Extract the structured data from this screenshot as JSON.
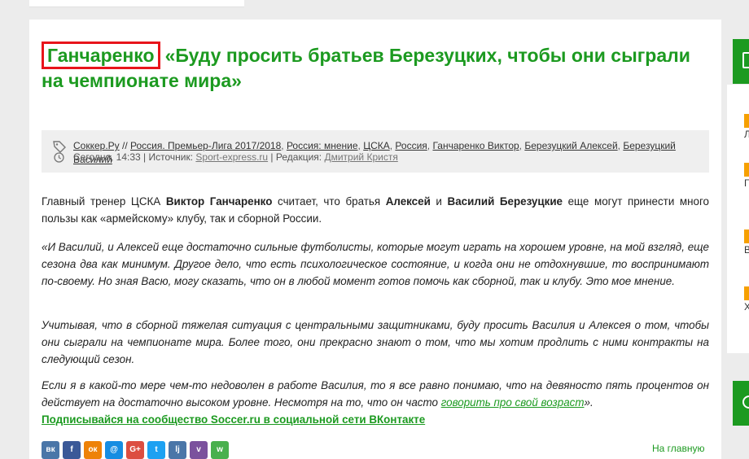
{
  "article": {
    "title_name": "Ганчаренко",
    "title_rest": "«Буду просить братьев Березуцких, чтобы они сыграли на чемпионате мира»",
    "meta": {
      "tags": [
        "Соккер.Ру",
        "Россия. Премьер-Лига 2017/2018",
        "Россия: мнение",
        "ЦСКА",
        "Россия",
        "Ганчаренко Виктор",
        "Березуцкий Алексей",
        "Березуцкий Василий"
      ],
      "tag_sep_first": " // ",
      "date": "Сегодня, 14:33",
      "source_label": "Источник:",
      "source_value": "Sport-express.ru",
      "editor_label": "Редакция:",
      "editor_value": "Дмитрий Кристя"
    },
    "p1": {
      "t1": "Главный тренер ЦСКА ",
      "b1": "Виктор Ганчаренко",
      "t2": " считает, что братья ",
      "b2": "Алексей",
      "t3": " и ",
      "b3": "Василий Березуцкие",
      "t4": " еще могут принести много пользы как «армейскому» клубу, так и сборной России."
    },
    "p2": "«И Василий, и Алексей еще достаточно сильные футболисты, которые могут играть на хорошем уровне, на мой взгляд, еще сезона два как минимум. Другое дело, что есть психологическое состояние, и когда они не отдохнувшие, то воспринимают по-своему. Но зная Васю, могу сказать, что он в любой момент готов помочь как сборной, так и клубу. Это мое мнение.",
    "p3": "Учитывая, что в сборной тяжелая ситуация с центральными защитниками, буду просить Василия и Алексея о том, чтобы они сыграли на чемпионате мира. Более того, они прекрасно знают о том, что мы хотим продлить с ними контракты на следующий сезон.",
    "p4": {
      "text": "Если я в какой-то мере чем-то недоволен в работе Василия, то я все равно понимаю, что на девяносто пять процентов он действует на достаточно высоком уровне. Несмотря на то, что он часто ",
      "link": "говорить про свой возраст",
      "end": "»."
    },
    "vk_link": "Подписывайся на сообщество Soccer.ru в социальной сети ВКонтакте",
    "share_buttons": [
      {
        "icon": "vk-icon",
        "glyph": "вк",
        "color": "#4a76a8"
      },
      {
        "icon": "facebook-icon",
        "glyph": "f",
        "color": "#3b5998"
      },
      {
        "icon": "odnoklassniki-icon",
        "glyph": "ок",
        "color": "#ee8208"
      },
      {
        "icon": "moimir-icon",
        "glyph": "@",
        "color": "#168de2"
      },
      {
        "icon": "google-plus-icon",
        "glyph": "G+",
        "color": "#dc4e41"
      },
      {
        "icon": "twitter-icon",
        "glyph": "t",
        "color": "#1da1f2"
      },
      {
        "icon": "livejournal-icon",
        "glyph": "lj",
        "color": "#4a76a8"
      },
      {
        "icon": "viber-icon",
        "glyph": "v",
        "color": "#7b519d"
      },
      {
        "icon": "whatsapp-icon",
        "glyph": "w",
        "color": "#48b04d"
      }
    ],
    "home_link": "На главную"
  },
  "sidebar": {
    "items": [
      "Л",
      "Г",
      "В",
      "Х"
    ]
  },
  "colors": {
    "accent": "#1c9a20",
    "highlight_border": "#e8141b",
    "sidebar_mark": "#f6a000"
  }
}
